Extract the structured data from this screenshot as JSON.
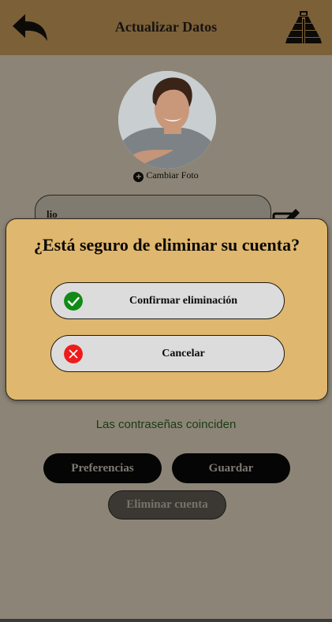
{
  "header": {
    "title": "Actualizar Datos",
    "back_icon": "back-arrow-icon",
    "logo_icon": "pyramid-logo-icon",
    "bar_color": "#7c6038"
  },
  "profile": {
    "change_photo_label": "Cambiar Foto",
    "name_value": "lio"
  },
  "status": {
    "password_match": "Las contraseñas coinciden",
    "color": "#1c3a12"
  },
  "actions": {
    "preferences_label": "Preferencias",
    "save_label": "Guardar",
    "delete_label": "Eliminar cuenta"
  },
  "modal": {
    "title": "¿Está seguro de eliminar su cuenta?",
    "confirm_label": "Confirmar eliminación",
    "cancel_label": "Cancelar",
    "confirm_icon": "check-circle-icon",
    "cancel_icon": "x-circle-icon",
    "background": "#dfb76e",
    "confirm_color": "#118a16",
    "cancel_color": "#ef1b1b"
  }
}
